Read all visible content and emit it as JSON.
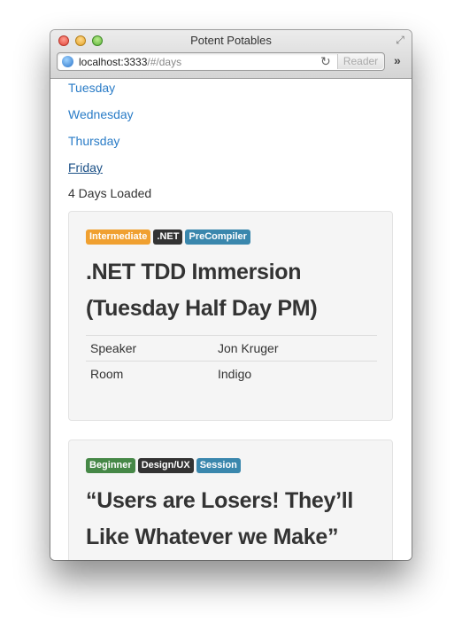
{
  "window": {
    "title": "Potent Potables"
  },
  "address_bar": {
    "host": "localhost:3333",
    "path": "/#/days",
    "reader_label": "Reader"
  },
  "days": [
    {
      "label": "Tuesday",
      "active": false
    },
    {
      "label": "Wednesday",
      "active": false
    },
    {
      "label": "Thursday",
      "active": false
    },
    {
      "label": "Friday",
      "active": true
    }
  ],
  "status": {
    "loaded_text": "4 Days Loaded"
  },
  "sessions": [
    {
      "tags": [
        {
          "text": "Intermediate",
          "color": "#f0a030"
        },
        {
          "text": ".NET",
          "color": "#333333"
        },
        {
          "text": "PreCompiler",
          "color": "#3a87ad"
        }
      ],
      "title_line1": ".NET TDD Immersion",
      "title_line2": "(Tuesday Half Day PM)",
      "speaker_label": "Speaker",
      "speaker_value": "Jon Kruger",
      "room_label": "Room",
      "room_value": "Indigo"
    },
    {
      "tags": [
        {
          "text": "Beginner",
          "color": "#468847"
        },
        {
          "text": "Design/UX",
          "color": "#333333"
        },
        {
          "text": "Session",
          "color": "#3a87ad"
        }
      ],
      "title_line1": "“Users are Losers! They’ll",
      "title_line2": "Like Whatever we Make”"
    }
  ],
  "icons": {
    "close": "close-button",
    "minimize": "minimize-button",
    "zoom": "zoom-button",
    "resize": "fullscreen-arrows-icon",
    "site": "globe-icon",
    "reload": "reload-icon",
    "overflow": "double-chevron-icon"
  }
}
